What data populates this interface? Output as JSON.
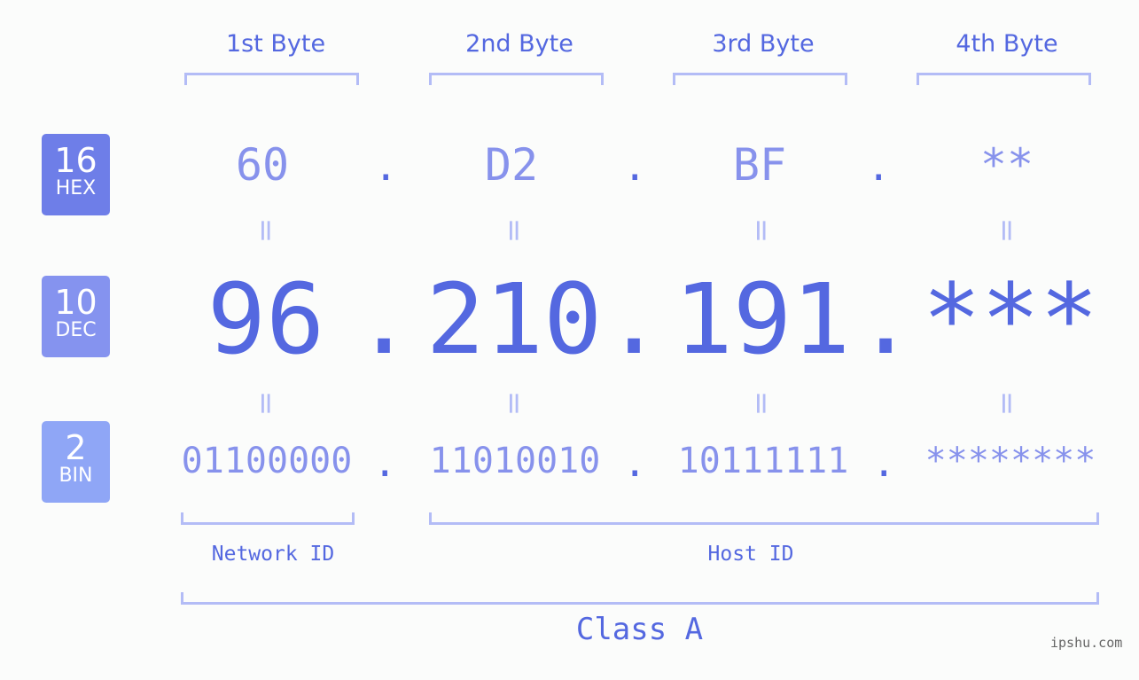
{
  "headers": [
    "1st Byte",
    "2nd Byte",
    "3rd Byte",
    "4th Byte"
  ],
  "badges": {
    "hex": {
      "num": "16",
      "label": "HEX",
      "color": "#6e7ee8"
    },
    "dec": {
      "num": "10",
      "label": "DEC",
      "color": "#8593ef"
    },
    "bin": {
      "num": "2",
      "label": "BIN",
      "color": "#8fa6f6"
    }
  },
  "hex": [
    "60",
    "D2",
    "BF",
    "**"
  ],
  "dec": [
    "96",
    "210",
    "191",
    "***"
  ],
  "bin": [
    "01100000",
    "11010010",
    "10111111",
    "********"
  ],
  "separator": ".",
  "equals": "=",
  "network_label": "Network ID",
  "host_label": "Host ID",
  "class_label": "Class A",
  "watermark": "ipshu.com",
  "colors": {
    "accent": "#5468e0",
    "muted": "#8792ec",
    "bracket": "#b3bcf6"
  }
}
